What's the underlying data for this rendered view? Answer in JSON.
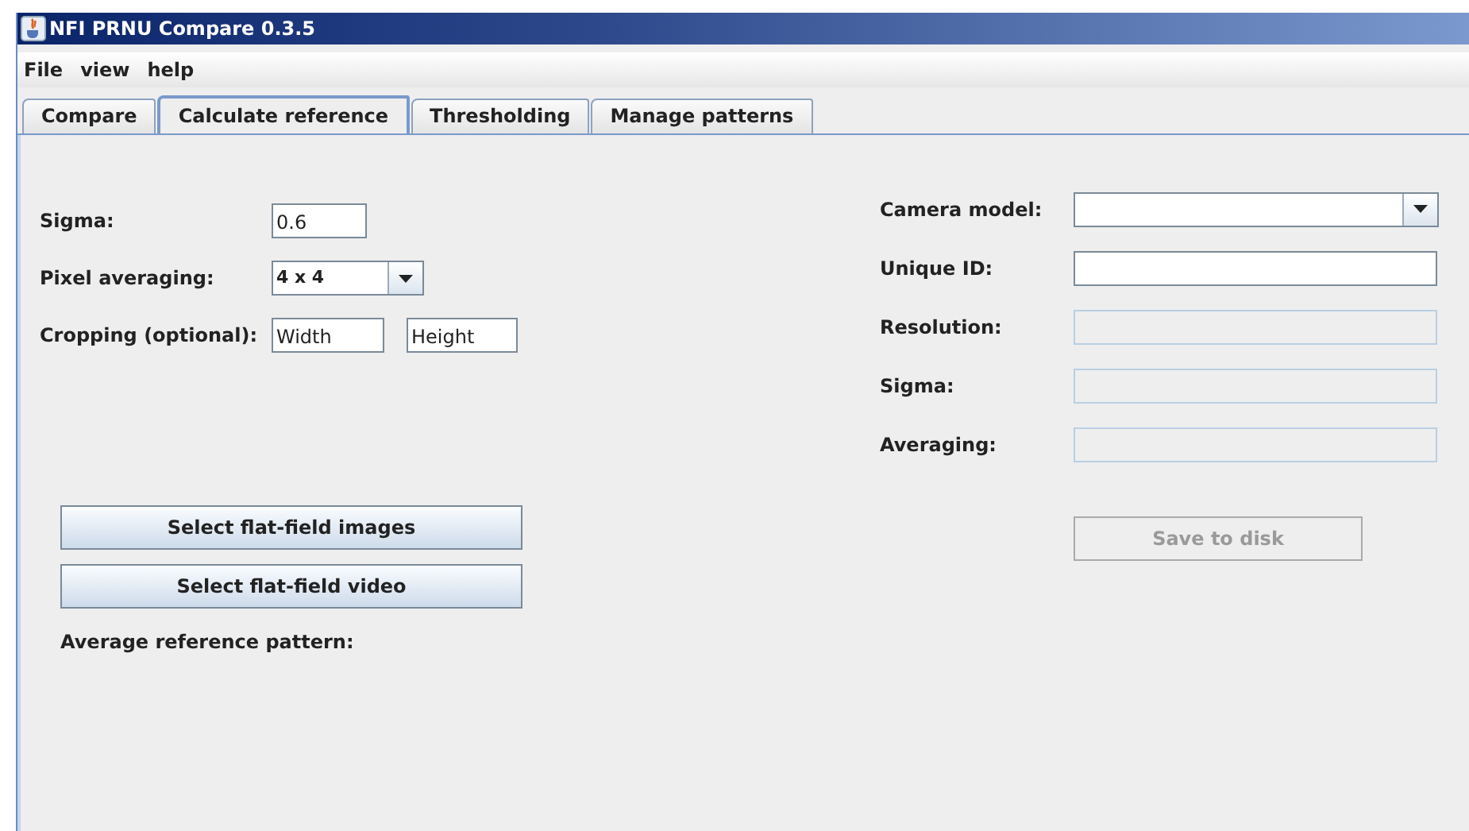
{
  "window": {
    "title": "NFI PRNU Compare 0.3.5"
  },
  "menu": [
    "File",
    "view",
    "help"
  ],
  "tabs": [
    {
      "label": "Compare",
      "selected": false
    },
    {
      "label": "Calculate reference",
      "selected": true
    },
    {
      "label": "Thresholding",
      "selected": false
    },
    {
      "label": "Manage patterns",
      "selected": false
    }
  ],
  "settings": {
    "rows": [
      {
        "label": "Sigma:",
        "kind": "text",
        "fields": [
          {
            "value": "0.6"
          }
        ]
      },
      {
        "label": "Pixel averaging:",
        "kind": "combo",
        "value": "4 x 4"
      },
      {
        "label": "Cropping (optional):",
        "kind": "text",
        "fields": [
          {
            "value": "Width"
          },
          {
            "value": "Height"
          }
        ]
      }
    ],
    "buttons": [
      "Select flat-field images",
      "Select flat-field video"
    ],
    "pattern_label": "Average reference pattern:"
  },
  "pattern_info": {
    "rows": [
      {
        "label": "Camera model:",
        "kind": "combo",
        "disabled": false
      },
      {
        "label": "Unique ID:",
        "kind": "text",
        "disabled": false
      },
      {
        "label": "Resolution:",
        "kind": "text",
        "disabled": true
      },
      {
        "label": "Sigma:",
        "kind": "text",
        "disabled": true
      },
      {
        "label": "Averaging:",
        "kind": "text",
        "disabled": true
      }
    ],
    "save_button": {
      "label": "Save to disk",
      "disabled": true
    }
  }
}
